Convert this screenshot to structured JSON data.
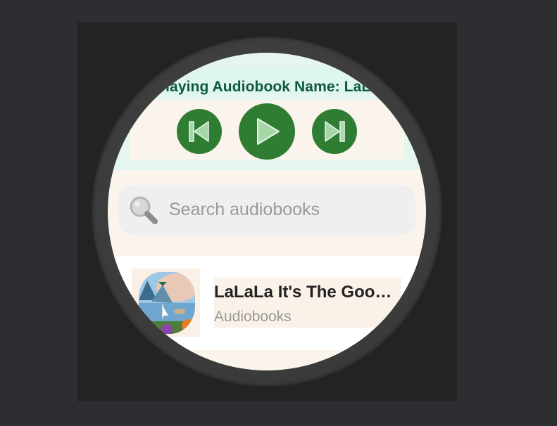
{
  "player": {
    "now_playing": "Playing Audiobook Name: LaLaLa It's The Good Life",
    "controls": {
      "previous": "skip-previous-icon",
      "play": "play-icon",
      "next": "skip-next-icon"
    },
    "accent_color": "#2e7d32",
    "title_color": "#0e5a3a"
  },
  "search": {
    "placeholder": "Search audiobooks",
    "value": ""
  },
  "list": {
    "items": [
      {
        "title": "LaLaLa It's The Good Life",
        "subtitle": "Audiobooks",
        "cover": "landscape-painting-thumbnail"
      }
    ]
  }
}
